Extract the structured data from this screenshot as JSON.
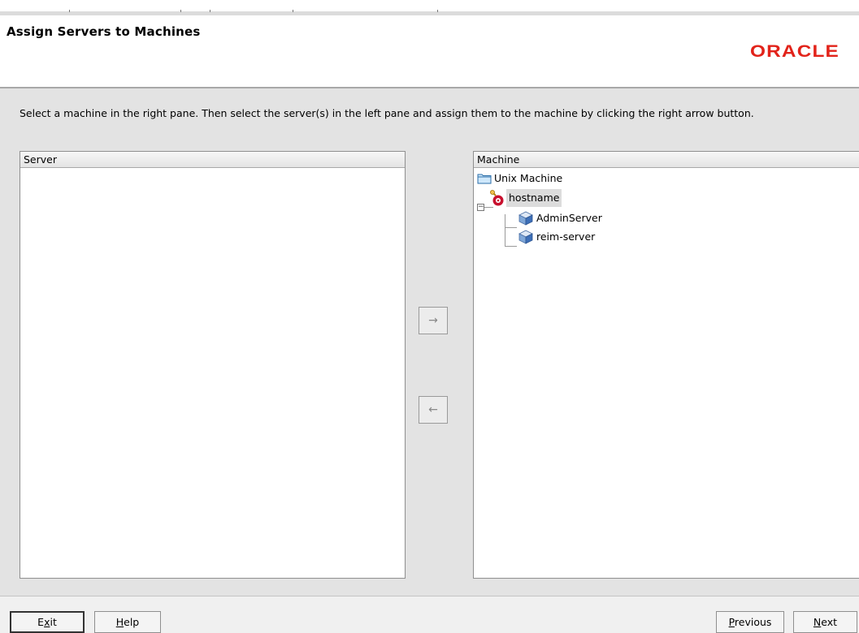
{
  "page": {
    "title": "Assign Servers to Machines",
    "brand": "ORACLE",
    "brand_color": "#e2231a",
    "instruction": "Select a machine in the right pane. Then select the server(s) in the left pane and assign them to the machine by clicking the right arrow button."
  },
  "server_pane": {
    "header": "Server",
    "items": []
  },
  "machine_pane": {
    "header": "Machine",
    "tree": {
      "root": {
        "label": "Unix Machine",
        "icon": "folder-icon"
      },
      "machine": {
        "label": "hostname",
        "icon": "machine-icon",
        "expanded": true,
        "selected": true,
        "children": [
          {
            "label": "AdminServer",
            "icon": "server-icon"
          },
          {
            "label": "reim-server",
            "icon": "server-icon"
          }
        ]
      }
    }
  },
  "controls": {
    "assign_arrow": "→",
    "unassign_arrow": "←"
  },
  "footer": {
    "exit": {
      "pre": "E",
      "mn": "x",
      "post": "it"
    },
    "help": {
      "pre": "",
      "mn": "H",
      "post": "elp"
    },
    "previous": {
      "pre": "",
      "mn": "P",
      "post": "revious"
    },
    "next": {
      "pre": "",
      "mn": "N",
      "post": "ext"
    }
  }
}
